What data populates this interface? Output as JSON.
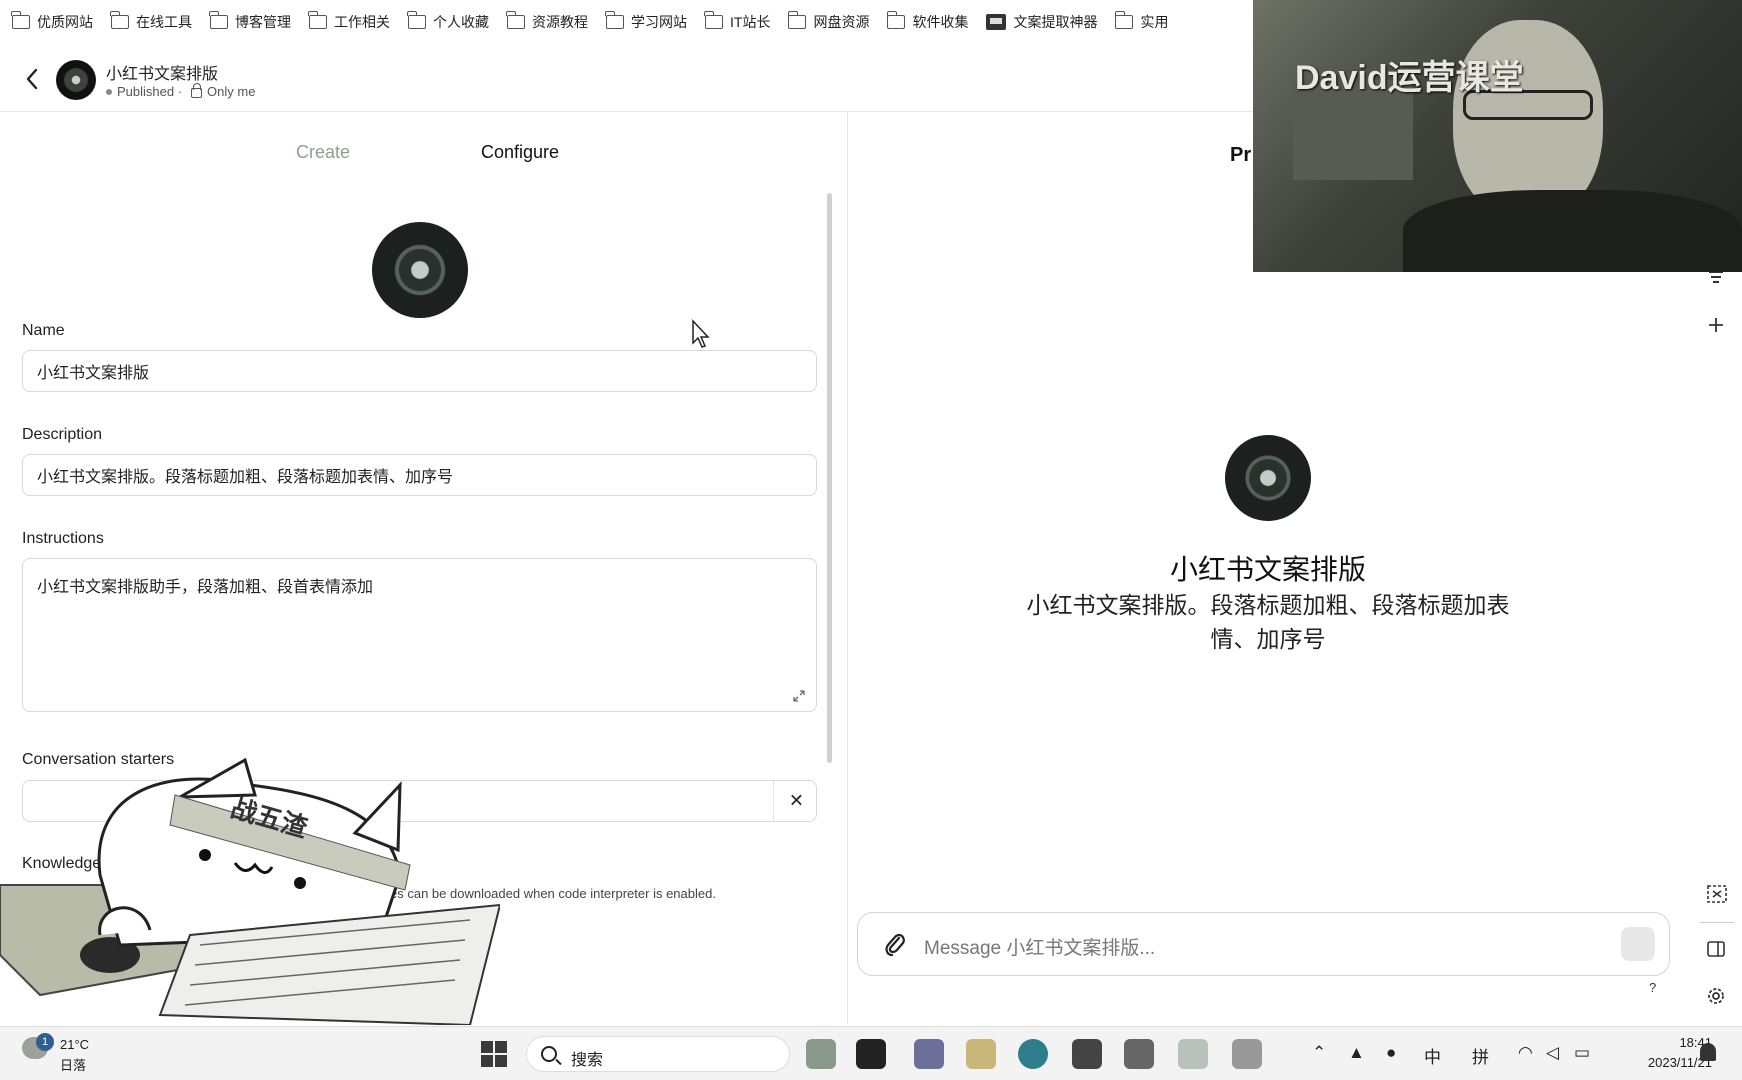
{
  "bookmarks": [
    {
      "label": "优质网站",
      "icon": "folder-icon"
    },
    {
      "label": "在线工具",
      "icon": "folder-icon"
    },
    {
      "label": "博客管理",
      "icon": "folder-icon"
    },
    {
      "label": "工作相关",
      "icon": "folder-icon"
    },
    {
      "label": "个人收藏",
      "icon": "folder-icon"
    },
    {
      "label": "资源教程",
      "icon": "folder-icon"
    },
    {
      "label": "学习网站",
      "icon": "folder-icon"
    },
    {
      "label": "IT站长",
      "icon": "folder-icon"
    },
    {
      "label": "网盘资源",
      "icon": "folder-icon"
    },
    {
      "label": "软件收集",
      "icon": "folder-icon"
    },
    {
      "label": "文案提取神器",
      "icon": "app-icon"
    },
    {
      "label": "实用",
      "icon": "folder-icon"
    }
  ],
  "header": {
    "title": "小红书文案排版",
    "status": "Published ·",
    "visibility": "Only me"
  },
  "tabs": {
    "create": "Create",
    "configure": "Configure"
  },
  "form": {
    "name_label": "Name",
    "name_value": "小红书文案排版",
    "description_label": "Description",
    "description_value": "小红书文案排版。段落标题加粗、段落标题加表情、加序号",
    "instructions_label": "Instructions",
    "instructions_value": "小红书文案排版助手，段落加粗、段首表情添加",
    "starters_label": "Conversation starters",
    "starter_remove": "✕",
    "knowledge_label": "Knowledge",
    "knowledge_desc": "es can be downloaded when code interpreter is enabled."
  },
  "sticker": {
    "headband_text": "战五渣"
  },
  "preview": {
    "label": "Pr",
    "name": "小红书文案排版",
    "description": "小红书文案排版。段落标题加粗、段落标题加表情、加序号",
    "message_placeholder": "Message 小红书文案排版...",
    "help": "?"
  },
  "webcam": {
    "overlay_text": "David运营课堂"
  },
  "taskbar": {
    "weather_badge": "1",
    "temperature": "21°C",
    "weather": "日落",
    "search_label": "搜索",
    "ime_lang": "中",
    "ime_mode": "拼",
    "time": "18:41",
    "date": "2023/11/21"
  },
  "colors": {
    "create_tab": "#8fa08f",
    "taskbar_bg": "#f3f3f3"
  }
}
